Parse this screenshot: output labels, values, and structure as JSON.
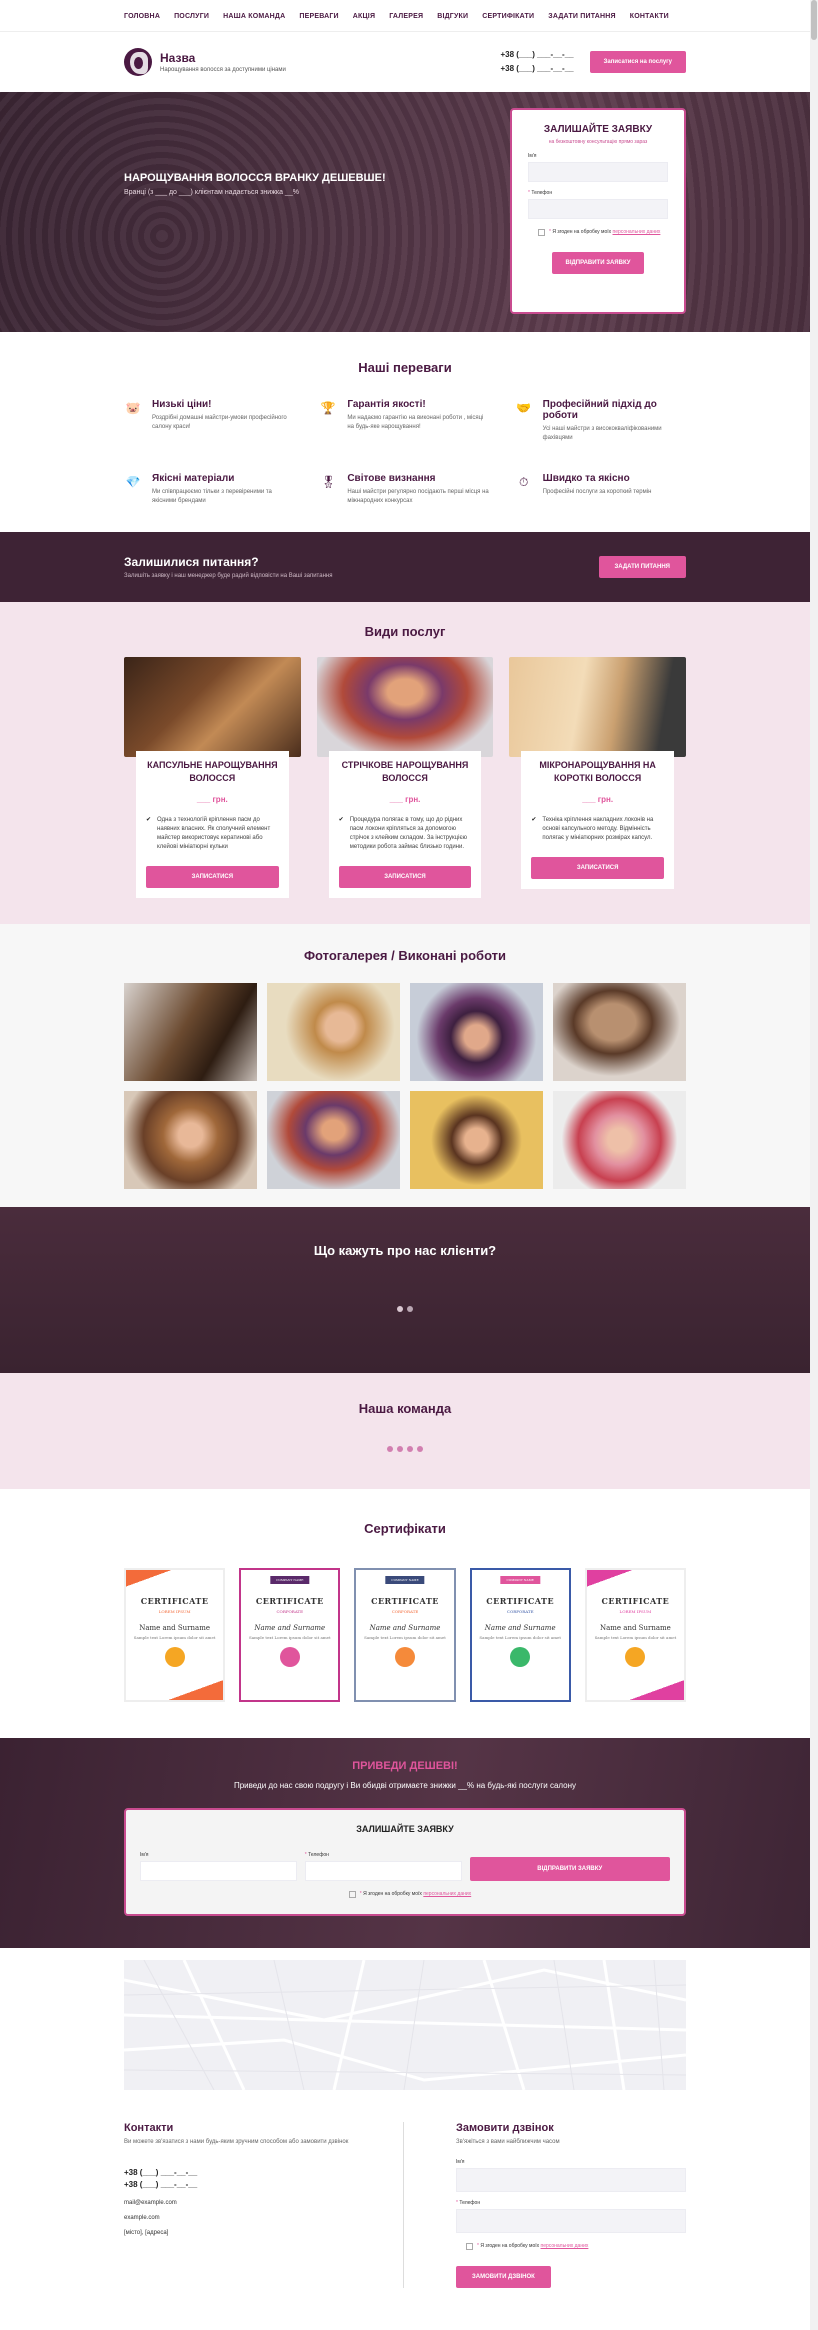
{
  "nav": [
    "ГОЛОВНА",
    "ПОСЛУГИ",
    "НАША КОМАНДА",
    "ПЕРЕВАГИ",
    "АКЦІЯ",
    "ГАЛЕРЕЯ",
    "ВІДГУКИ",
    "СЕРТИФІКАТИ",
    "ЗАДАТИ ПИТАННЯ",
    "КОНТАКТИ"
  ],
  "header": {
    "brand": "Назва",
    "tagline": "Нарощування волосся за доступними цінами",
    "phone1": "+38 (___) ___-__-__",
    "phone2": "+38 (___) ___-__-__",
    "cta": "Записатися на послугу"
  },
  "hero": {
    "title": "НАРОЩУВАННЯ ВОЛОССЯ ВРАНКУ ДЕШЕВШЕ!",
    "subtitle": "Вранці (з ___ до ___) клієнтам надається знижка __%"
  },
  "form": {
    "title": "ЗАЛИШАЙТЕ ЗАЯВКУ",
    "subtitle": "на безкоштовну консультацію прямо зараз",
    "name_label": "Ім'я",
    "phone_label": "Телефон",
    "consent": "Я згоден на обробку моїх",
    "consent_link": "персональних даних",
    "submit": "ВІДПРАВИТИ ЗАЯВКУ"
  },
  "advantages": {
    "title": "Наші переваги",
    "items": [
      {
        "title": "Низькі ціни!",
        "desc": "Роздрібні домашні майстри-умови професійного салону краси!",
        "icon": "piggy-bank-icon"
      },
      {
        "title": "Гарантія якості!",
        "desc": "Ми надаємо гарантію на виконані роботи , місяці на будь-яке нарощування!",
        "icon": "trophy-icon"
      },
      {
        "title": "Професійний підхід до роботи",
        "desc": "Усі наші майстри з висококваліфікованими фахівцями",
        "icon": "handshake-icon"
      },
      {
        "title": "Якісні матеріали",
        "desc": "Ми співпрацюємо тільки з перевіреними та якісними брендами",
        "icon": "diamond-icon"
      },
      {
        "title": "Світове визнання",
        "desc": "Наші майстри регулярно посідають перші місця на міжнародних конкурсах",
        "icon": "medal-icon"
      },
      {
        "title": "Швидко та якісно",
        "desc": "Професійні послуги за короткий термін",
        "icon": "clock-icon"
      }
    ]
  },
  "questions": {
    "title": "Залишилися питання?",
    "subtitle": "Залишіть заявку і наш менеджер буде радий відповісти на Ваші запитання",
    "cta": "ЗАДАТИ ПИТАННЯ"
  },
  "services": {
    "title": "Види послуг",
    "items": [
      {
        "name": "КАПСУЛЬНЕ НАРОЩУВАННЯ ВОЛОССЯ",
        "price": "___ грн.",
        "desc": "Одна з технологій кріплення пасм до наявних власних. Як сполучний елемент майстер використовує кератинові або клейові мініатюрні кульки",
        "cta": "ЗАПИСАТИСЯ"
      },
      {
        "name": "СТРІЧКОВЕ НАРОЩУВАННЯ ВОЛОССЯ",
        "price": "___ грн.",
        "desc": "Процедура полягає в тому, що до рідних пасм локони кріпляться за допомогою стрічок з клейким складом. За інструкцією методики робота займає близько години.",
        "cta": "ЗАПИСАТИСЯ"
      },
      {
        "name": "МІКРОНАРОЩУВАННЯ НА КОРОТКІ ВОЛОССЯ",
        "price": "___ грн.",
        "desc": "Техніка кріплення накладних локонів на основі капсульного методу. Відмінність полягає у мініатюрних розмірах капсул.",
        "cta": "ЗАПИСАТИСЯ"
      }
    ]
  },
  "gallery": {
    "title": "Фотогалерея / Виконані роботи"
  },
  "reviews": {
    "title": "Що кажуть про нас клієнти?"
  },
  "team": {
    "title": "Наша команда"
  },
  "certificates": {
    "title": "Сертифікати",
    "items": [
      {
        "title": "CERTIFICATE",
        "sub": "LOREM IPSUM",
        "name": "Name and Surname",
        "desc": "Sample text Lorem ipsum dolor sit amet",
        "tag": ""
      },
      {
        "title": "CERTIFICATE",
        "sub": "CORPORATE",
        "name": "Name and Surname",
        "desc": "Sample text Lorem ipsum dolor sit amet",
        "tag": "COMPANY NAME"
      },
      {
        "title": "CERTIFICATE",
        "sub": "CORPORATE",
        "name": "Name and Surname",
        "desc": "Sample text Lorem ipsum dolor sit amet",
        "tag": "COMPANY NAME"
      },
      {
        "title": "CERTIFICATE",
        "sub": "CORPORATE",
        "name": "Name and Surname",
        "desc": "Sample text Lorem ipsum dolor sit amet",
        "tag": "COMPANY NAME"
      },
      {
        "title": "CERTIFICATE",
        "sub": "LOREM IPSUM",
        "name": "Name and Surname",
        "desc": "Sample text Lorem ipsum dolor sit amet",
        "tag": ""
      }
    ]
  },
  "promo": {
    "title": "ПРИВЕДИ ДЕШЕВІ!",
    "subtitle": "Приведи до нас свою подругу і Ви обидві отримаєте знижки __% на будь-які послуги салону",
    "form_title": "ЗАЛИШАЙТЕ ЗАЯВКУ",
    "name_label": "Ім'я",
    "phone_label": "Телефон",
    "submit": "ВІДПРАВИТИ ЗАЯВКУ",
    "consent": "Я згоден на обробку моїх",
    "consent_link": "персональних даних"
  },
  "contacts": {
    "title": "Контакти",
    "subtitle": "Ви можете зв'язатися з нами будь-яким зручним способом або замовити дзвінок",
    "phone1": "+38 (___) ___-__-__",
    "phone2": "+38 (___) ___-__-__",
    "email": "mail@example.com",
    "site": "example.com",
    "address": "[місто], [адреса]"
  },
  "callback": {
    "title": "Замовити дзвінок",
    "subtitle": "Зв'яжіться з вами найближчим часом",
    "name_label": "Ім'я",
    "phone_label": "Телефон",
    "consent": "Я згоден на обробку моїх",
    "consent_link": "персональних даних",
    "submit": "ЗАМОВИТИ ДЗВІНОК"
  },
  "colors": {
    "accent": "#e0559c",
    "brand": "#4a1942",
    "dark": "#3e2335",
    "pinkbg": "#f4e4ec"
  }
}
